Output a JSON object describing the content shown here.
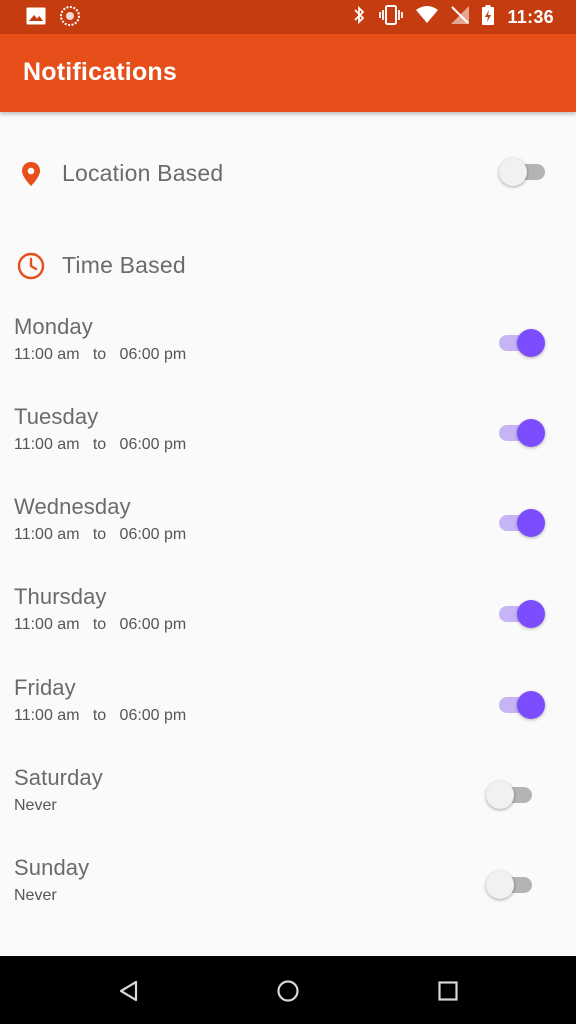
{
  "status_bar": {
    "time": "11:36",
    "icons": [
      "gallery-icon",
      "app-icon",
      "bluetooth-icon",
      "vibrate-icon",
      "wifi-icon",
      "no-sim-icon",
      "battery-charging-icon"
    ]
  },
  "app_bar": {
    "title": "Notifications"
  },
  "location": {
    "label": "Location Based",
    "enabled": false,
    "icon": "location-pin-icon",
    "icon_color": "#e64f1a"
  },
  "time_based": {
    "label": "Time Based",
    "icon": "clock-icon",
    "icon_color": "#e64f1a"
  },
  "days": [
    {
      "name": "Monday",
      "range": "11:00 am   to   06:00 pm",
      "enabled": true
    },
    {
      "name": "Tuesday",
      "range": "11:00 am   to   06:00 pm",
      "enabled": true
    },
    {
      "name": "Wednesday",
      "range": "11:00 am   to   06:00 pm",
      "enabled": true
    },
    {
      "name": "Thursday",
      "range": "11:00 am   to   06:00 pm",
      "enabled": true
    },
    {
      "name": "Friday",
      "range": "11:00 am   to   06:00 pm",
      "enabled": true
    },
    {
      "name": "Saturday",
      "range": "Never",
      "enabled": false
    },
    {
      "name": "Sunday",
      "range": "Never",
      "enabled": false
    }
  ],
  "colors": {
    "primary": "#e64f1a",
    "status_bar": "#c43c0f",
    "accent": "#7c4dff"
  },
  "nav_bar": {
    "buttons": [
      "back-icon",
      "home-icon",
      "recents-icon"
    ]
  }
}
